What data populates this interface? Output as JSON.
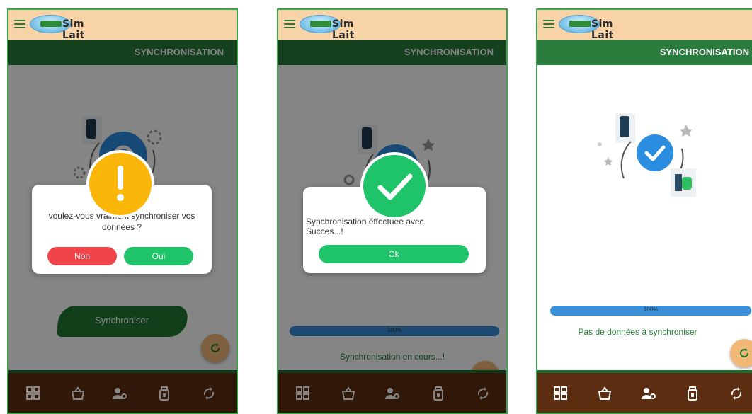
{
  "app": {
    "name": "Sim Lait",
    "page_title": "SYNCHRONISATION"
  },
  "screen1": {
    "dialog_message": "voulez-vous vraiment synchroniser vos données  ?",
    "cancel_label": "Non",
    "confirm_label": "Oui",
    "sync_button_label": "Synchroniser"
  },
  "screen2": {
    "dialog_message": "Synchronisation  éffectuée avec Succes...!",
    "ok_label": "Ok",
    "progress_text": "100%",
    "progress_value": 1.0,
    "status_text": "Synchronisation en cours...!"
  },
  "screen3": {
    "progress_text": "100%",
    "progress_value": 1.0,
    "status_text": "Pas de données à synchroniser"
  },
  "bottom_nav": [
    "dashboard-icon",
    "basket-icon",
    "user-settings-icon",
    "milk-can-icon",
    "sync-icon"
  ],
  "colors": {
    "appbar": "#f7d3a7",
    "titlebar": "#2a7d3c",
    "bottom_nav": "#5c2d10",
    "confirm_green": "#1fc46a",
    "cancel_red": "#f0444a",
    "warning_yellow": "#fbb60a",
    "progress_blue": "#3b8fd9"
  }
}
